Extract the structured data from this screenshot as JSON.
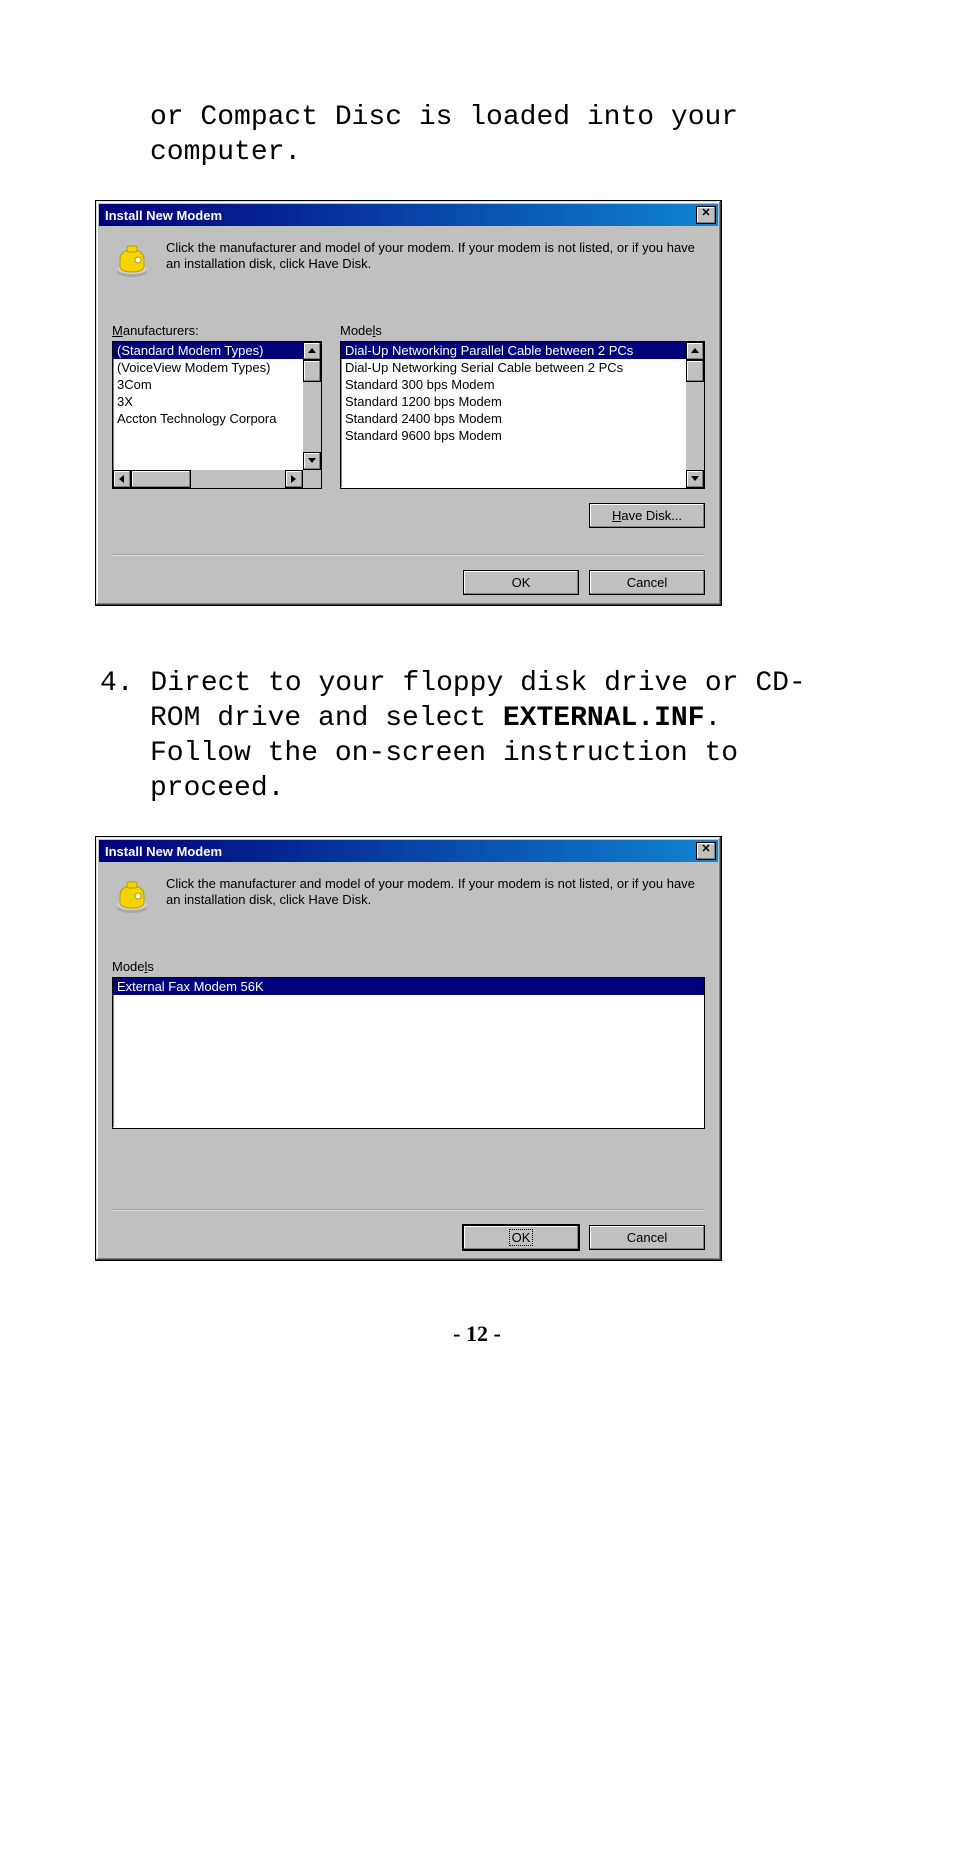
{
  "doc": {
    "top_para": "or Compact Disc is loaded into your computer.",
    "step4_num": "4.",
    "step4_a": "Direct to your floppy disk drive or CD-ROM drive and select ",
    "step4_bold": "EXTERNAL.INF",
    "step4_b": ". Follow the on-screen instruction to proceed.",
    "page_number": "- 12 -"
  },
  "dlg1": {
    "title": "Install New Modem",
    "intro": "Click the manufacturer and model of your modem. If your modem is not listed, or if you have an installation disk, click Have Disk.",
    "man_label_pre": "M",
    "man_label_rest": "anufacturers:",
    "mod_label_pre": "Mode",
    "mod_label_u": "l",
    "mod_label_rest": "s",
    "manufacturers": [
      "(Standard Modem Types)",
      "(VoiceView Modem Types)",
      "3Com",
      "3X",
      "Accton Technology Corpora"
    ],
    "models": [
      "Dial-Up Networking Parallel Cable between 2 PCs",
      "Dial-Up Networking Serial Cable between 2 PCs",
      "Standard   300 bps Modem",
      "Standard  1200 bps Modem",
      "Standard  2400 bps Modem",
      "Standard  9600 bps Modem"
    ],
    "have_disk_pre": "H",
    "have_disk_rest": "ave Disk...",
    "ok": "OK",
    "cancel": "Cancel"
  },
  "dlg2": {
    "title": "Install New Modem",
    "intro": "Click the manufacturer and model of your modem. If your modem is not listed, or if you have an installation disk, click Have Disk.",
    "mod_label_pre": "Mode",
    "mod_label_u": "l",
    "mod_label_rest": "s",
    "model": "External Fax Modem 56K",
    "ok": "OK",
    "cancel": "Cancel"
  }
}
